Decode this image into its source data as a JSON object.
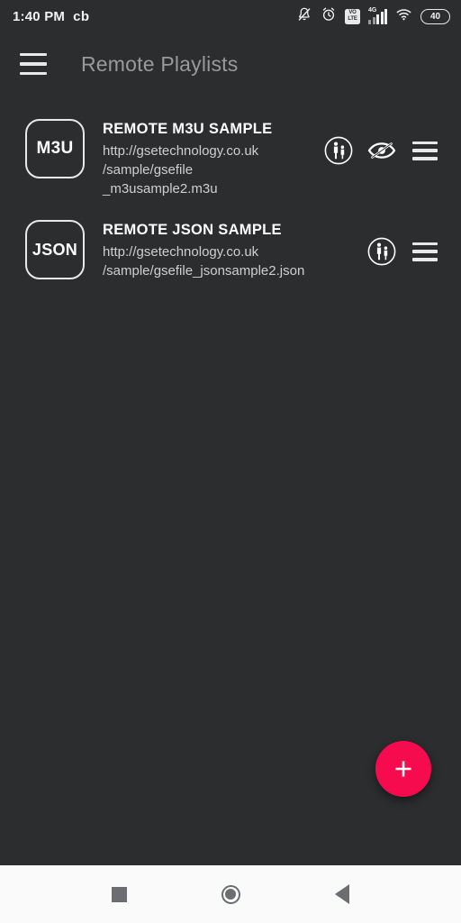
{
  "statusbar": {
    "clock": "1:40 PM",
    "carrier_label": "cb",
    "icons": [
      "bell-muted-icon",
      "alarm-clock-icon",
      "volte-icon",
      "signal-4g-icon",
      "wifi-icon",
      "battery-icon"
    ],
    "volte_top": "VO",
    "volte_bottom": "LTE",
    "network_type": "4G",
    "battery_level": "40"
  },
  "appbar": {
    "menu_icon": "hamburger-menu-icon",
    "title": "Remote Playlists"
  },
  "playlists": [
    {
      "badge": "M3U",
      "title": "REMOTE M3U SAMPLE",
      "url": "http://gsetechnology.co.uk\n/sample/gsefile\n_m3usample2.m3u",
      "actions": [
        "parental-control-icon",
        "eye-off-icon",
        "row-menu-icon"
      ]
    },
    {
      "badge": "JSON",
      "title": "REMOTE JSON SAMPLE",
      "url": "http://gsetechnology.co.uk\n/sample/gsefile_jsonsample2.json",
      "actions": [
        "parental-control-icon",
        "row-menu-icon"
      ]
    }
  ],
  "fab": {
    "icon": "plus-icon",
    "color": "#f50b4e"
  },
  "navbar": {
    "buttons": [
      "recents-square-icon",
      "home-circle-icon",
      "back-triangle-icon"
    ]
  },
  "colors": {
    "background": "#2b2d2e",
    "appbar_title": "#9a9a9a",
    "primary_text": "#ffffff",
    "secondary_text": "#cfcfcf",
    "accent": "#f50b4e",
    "navbar_background": "#fafafa"
  }
}
